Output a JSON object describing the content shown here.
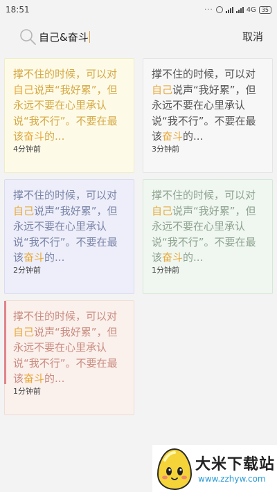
{
  "status_bar": {
    "time": "18:51",
    "network": "4G",
    "battery": "35"
  },
  "search": {
    "query": "自己&奋斗",
    "cancel_label": "取消"
  },
  "notes": [
    {
      "segments": [
        "撑不住的时候，可以对",
        "自己",
        "说声“我好累”，但永远不要在心里承认说“我不行”。不要在最该",
        "奋斗",
        "的..."
      ],
      "time": "4分钟前",
      "color": "yellow"
    },
    {
      "segments": [
        "撑不住的时候，可以对",
        "自己",
        "说声“我好累”，但永远不要在心里承认说“我不行”。不要在最该",
        "奋斗",
        "的..."
      ],
      "time": "3分钟前",
      "color": "gray"
    },
    {
      "segments": [
        "撑不住的时候，可以对",
        "自己",
        "说声“我好累”，但永远不要在心里承认说“我不行”。不要在最该",
        "奋斗",
        "的..."
      ],
      "time": "2分钟前",
      "color": "blue"
    },
    {
      "segments": [
        "撑不住的时候，可以对",
        "自己",
        "说声“我好累”，但永远不要在心里承认说“我不行”。不要在最该",
        "奋斗",
        "的..."
      ],
      "time": "1分钟前",
      "color": "green"
    },
    {
      "segments": [
        "撑不住的时候，可以对",
        "自己",
        "说声“我好累”，但永远不要在心里承认说“我不行”。不要在最该",
        "奋斗",
        "的..."
      ],
      "time": "1分钟前",
      "color": "red"
    }
  ],
  "watermark": {
    "title": "大米下载站",
    "url": "www.zzhyw.com"
  },
  "colors": {
    "highlight": "#e9a93a",
    "caret": "#e8a23c",
    "red_marker": "#e0858a"
  }
}
